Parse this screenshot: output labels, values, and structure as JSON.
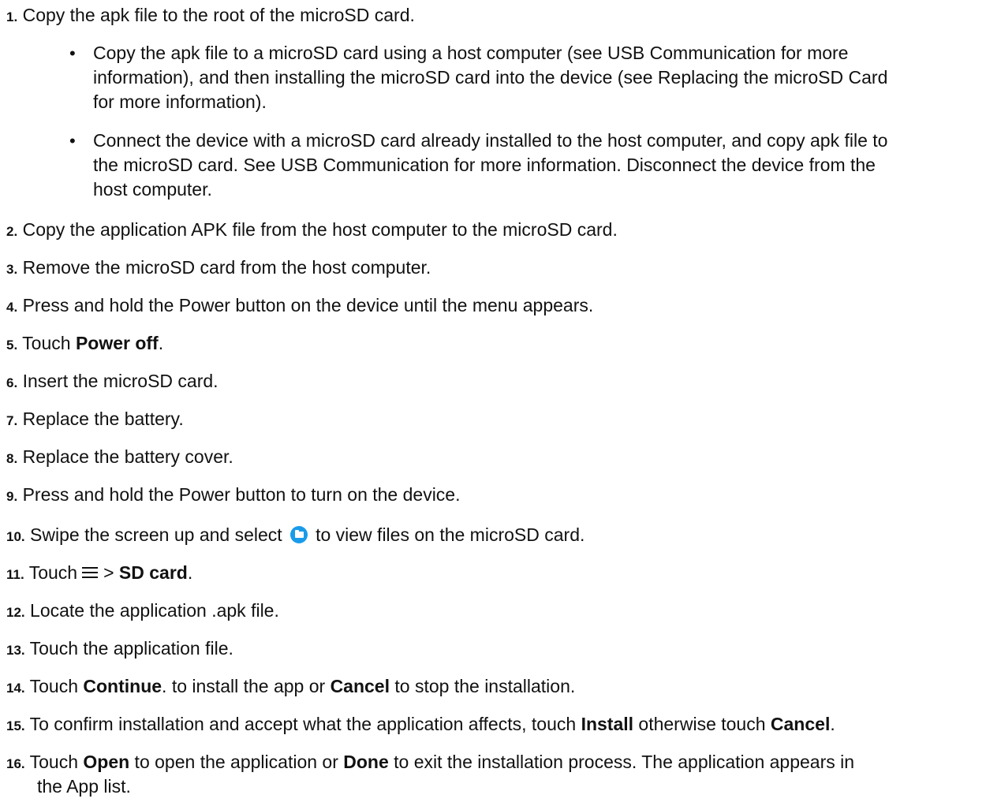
{
  "steps": [
    {
      "num": "1.",
      "text": "Copy the apk file to the root of the microSD card."
    },
    {
      "num": "2.",
      "text": "Copy the application APK file from the host computer to the microSD card."
    },
    {
      "num": "3.",
      "text": "Remove the microSD card from the host computer."
    },
    {
      "num": "4.",
      "text": "Press and hold the Power button on the device until the menu appears."
    },
    {
      "num": "5.",
      "pre": "Touch ",
      "bold": "Power off",
      "post": "."
    },
    {
      "num": "6.",
      "text": "Insert the microSD card."
    },
    {
      "num": "7.",
      "text": "Replace the battery."
    },
    {
      "num": "8.",
      "text": "Replace the battery cover."
    },
    {
      "num": "9.",
      "text": "Press and hold the Power button to turn on the device."
    },
    {
      "num": "10.",
      "pre": "Swipe the screen up and select",
      "icon": "folder-icon",
      "post": "to view files on the microSD card."
    },
    {
      "num": "11.",
      "pre": "Touch",
      "icon": "menu-icon",
      "mid": "> ",
      "bold": "SD card",
      "post": "."
    },
    {
      "num": "12.",
      "text": "Locate the application .apk file."
    },
    {
      "num": "13.",
      "text": "Touch the application file."
    },
    {
      "num": "14.",
      "pre": "Touch ",
      "bold": "Continue",
      "mid": ". to install the app or ",
      "bold2": "Cancel",
      "post": " to stop the installation."
    },
    {
      "num": "15.",
      "pre": "To confirm installation and accept what the application affects, touch ",
      "bold": "Install",
      "mid": " otherwise touch ",
      "bold2": "Cancel",
      "post": "."
    },
    {
      "num": "16.",
      "pre": "Touch ",
      "bold": "Open",
      "mid": " to open the application or ",
      "bold2": "Done",
      "post": " to exit the installation process. The application appears in",
      "line2": "the App list."
    }
  ],
  "bullets": [
    {
      "dot": "•",
      "lines": [
        "Copy the apk file to a microSD card using a host computer (see USB Communication for more",
        "information), and then installing the microSD card into the device (see Replacing the microSD Card",
        "for more information)."
      ]
    },
    {
      "dot": "•",
      "lines": [
        "Connect the device with a microSD card already installed to the host computer, and copy apk file to",
        "the microSD card. See USB Communication for more information. Disconnect the device from the",
        "host computer."
      ]
    }
  ],
  "colors": {
    "text": "#111111",
    "folder_icon": "#1a9bea"
  }
}
